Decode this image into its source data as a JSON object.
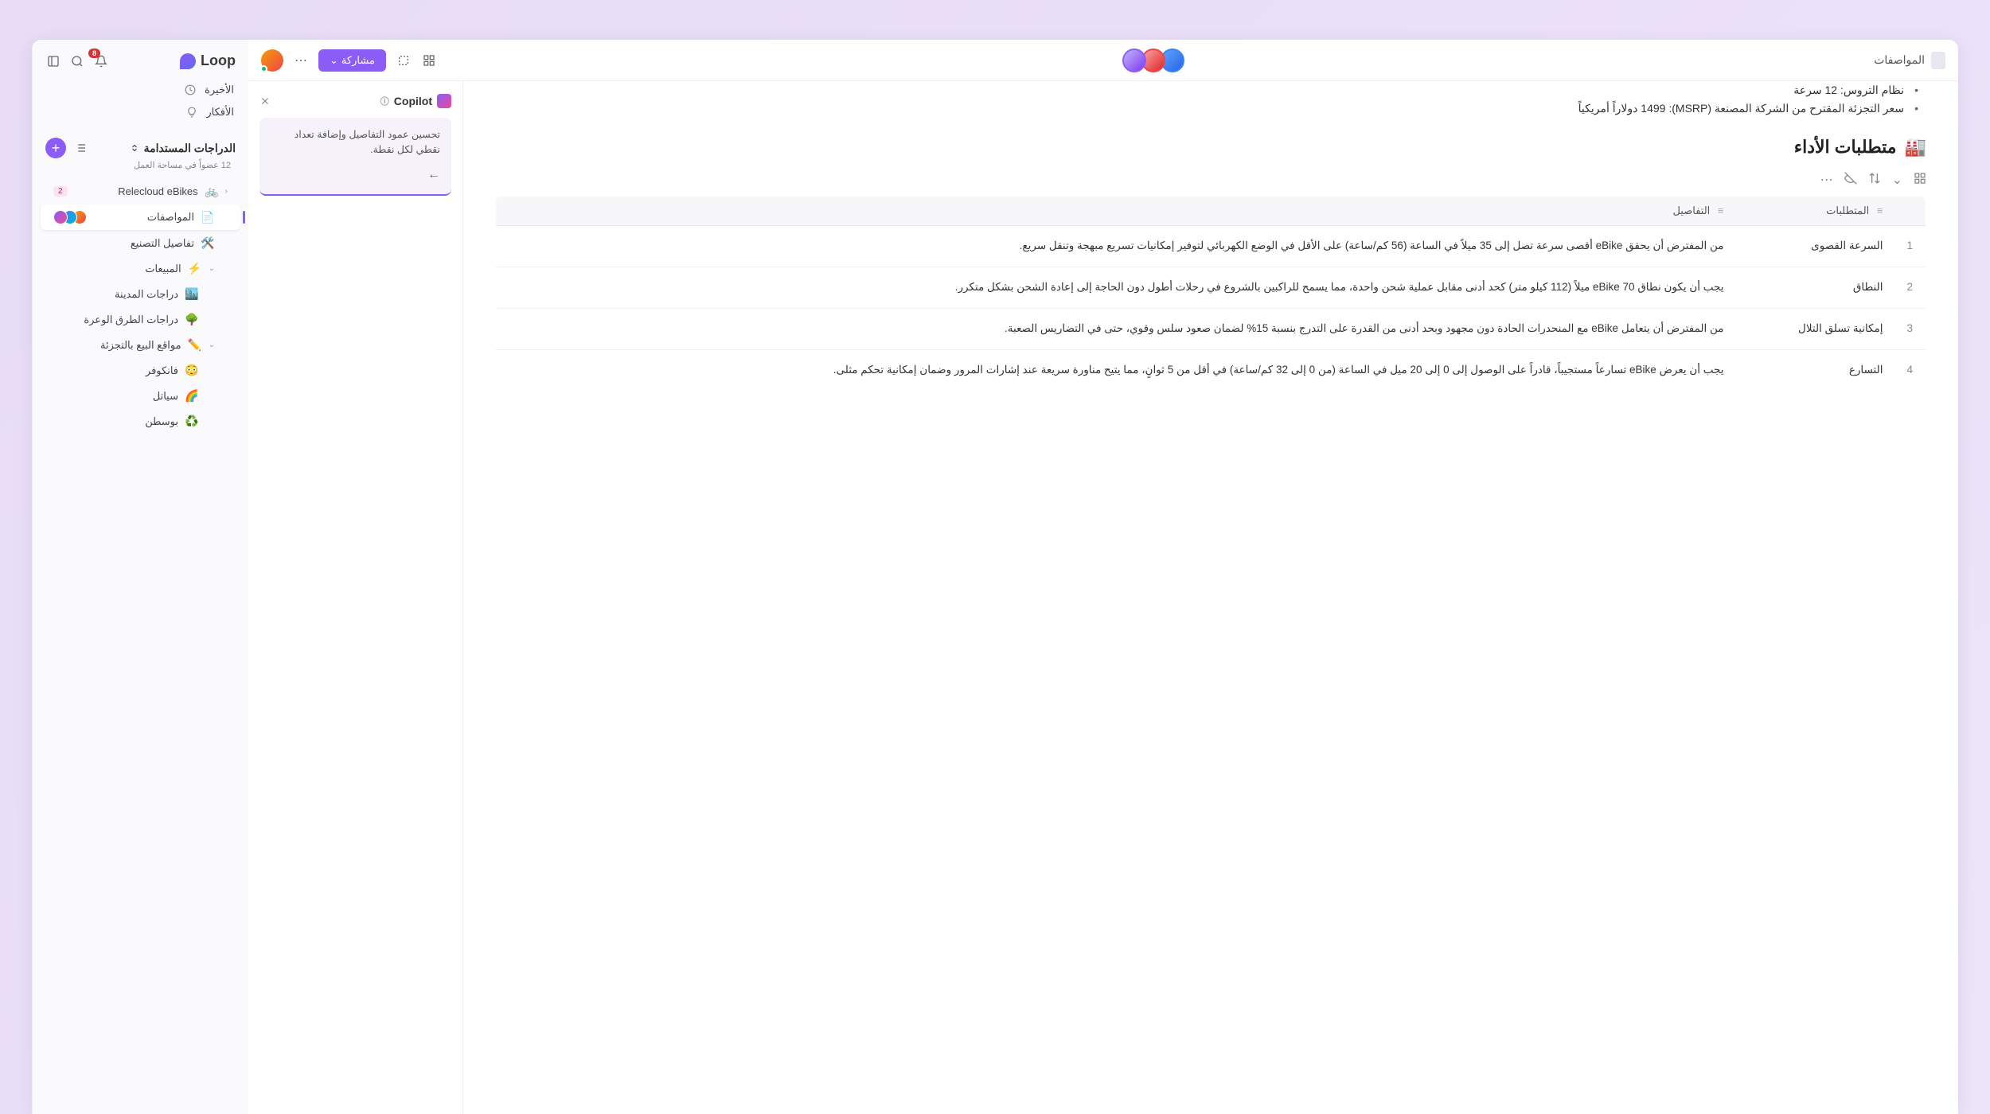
{
  "app": {
    "name": "Loop",
    "notification_count": "8"
  },
  "nav": {
    "recent": "الأخيرة",
    "ideas": "الأفكار"
  },
  "workspace": {
    "title": "الدراجات المستدامة",
    "members": "12 عضواً في مساحة العمل"
  },
  "tree": {
    "relecloud": "Relecloud eBikes",
    "relecloud_badge": "2",
    "specs": "المواصفات",
    "manufacturing": "تفاصيل التصنيع",
    "sales": "المبيعات",
    "city_bikes": "دراجات المدينة",
    "offroad": "دراجات الطرق الوعرة",
    "retail": "مواقع البيع بالتجزئة",
    "vancouver": "فانكوفر",
    "seattle": "سياتل",
    "boston": "بوسطن"
  },
  "topbar": {
    "doc_title": "المواصفات",
    "share": "مشاركة"
  },
  "document": {
    "bullets": [
      "نظام التروس: 12 سرعة",
      "سعر التجزئة المقترح من الشركة المصنعة (MSRP): 1499 دولاراً أمريكياً"
    ],
    "section_heading": "متطلبات الأداء",
    "section_emoji": "🏭",
    "columns": {
      "requirements": "المتطلبات",
      "details": "التفاصيل"
    },
    "rows": [
      {
        "num": "1",
        "req": "السرعة القصوى",
        "detail": "من المفترض أن يحقق eBike أقصى سرعة تصل إلى 35 ميلاً في الساعة (56 كم/ساعة) على الأقل في الوضع الكهربائي لتوفير إمكانيات تسريع مبهجة وتنقل سريع."
      },
      {
        "num": "2",
        "req": "النطاق",
        "detail": "يجب أن يكون نطاق eBike 70 ميلاً (112 كيلو متر) كحد أدنى مقابل عملية شحن واحدة، مما يسمح للراكبين بالشروع في رحلات أطول دون الحاجة إلى إعادة الشحن بشكل متكرر."
      },
      {
        "num": "3",
        "req": "إمكانية تسلق التلال",
        "detail": "من المفترض أن يتعامل eBike مع المنحدرات الحادة دون مجهود وبحد أدنى من القدرة على التدرج بنسبة 15% لضمان صعود سلس وقوي، حتى في التضاريس الصعبة."
      },
      {
        "num": "4",
        "req": "التسارع",
        "detail": "يجب أن يعرض eBike تسارعاً مستجيباً، قادراً على الوصول إلى 0 إلى 20 ميل في الساعة (من 0 إلى 32 كم/ساعة) في أقل من 5 ثوانٍ، مما يتيح مناورة سريعة عند إشارات المرور وضمان إمكانية تحكم مثلى."
      }
    ]
  },
  "copilot": {
    "title": "Copilot",
    "suggestion": "تحسين عمود التفاصيل وإضافة تعداد نقطي لكل نقطة."
  }
}
